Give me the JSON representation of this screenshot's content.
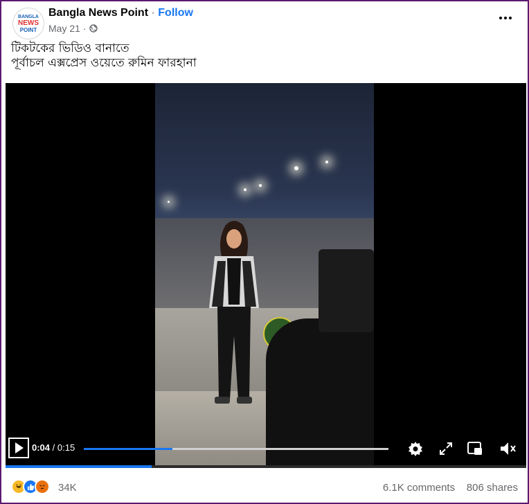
{
  "post": {
    "page_name": "Bangla News Point",
    "separator": "·",
    "follow_label": "Follow",
    "date": "May 21",
    "avatar_text": {
      "line1": "BANGLA",
      "line2": "NEWS",
      "line3": "POINT"
    },
    "privacy_icon": "globe-icon",
    "more_icon": "more-options-icon",
    "caption_line1": "টিকটকের ভিডিও বানাতে",
    "caption_line2": "পূর্বাচল এক্সপ্রেস ওয়েতে রুমিন ফারহানা"
  },
  "video": {
    "current_time": "0:04",
    "time_separator": " / ",
    "duration": "0:15",
    "progress": 0.29,
    "buffered_bar": 0.28,
    "icons": [
      "play-icon",
      "settings-icon",
      "fullscreen-icon",
      "picture-in-picture-icon",
      "volume-muted-icon"
    ],
    "accent_color": "#1877f2"
  },
  "footer": {
    "reaction_icons": [
      "haha-icon",
      "like-icon",
      "angry-icon"
    ],
    "reaction_count": "34K",
    "comments": "6.1K comments",
    "shares": "806 shares"
  }
}
